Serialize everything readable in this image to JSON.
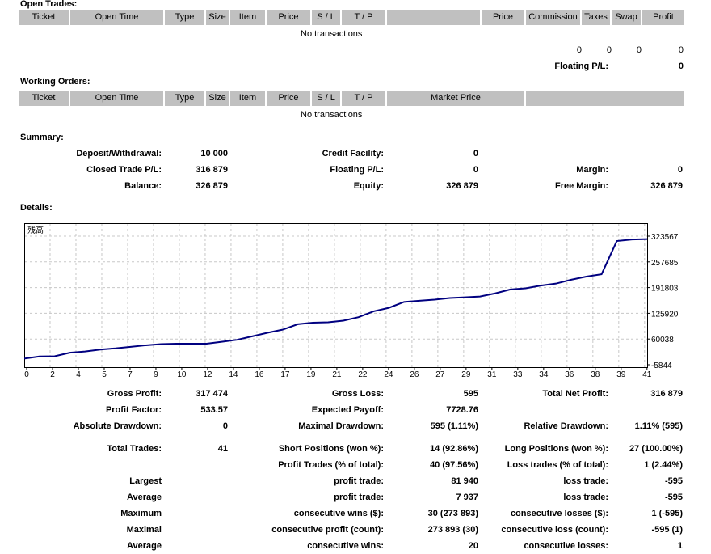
{
  "open_trades": {
    "title": "Open Trades:",
    "columns": [
      "Ticket",
      "Open Time",
      "Type",
      "Size",
      "Item",
      "Price",
      "S / L",
      "T / P",
      "",
      "Price",
      "Commission",
      "Taxes",
      "Swap",
      "Profit"
    ],
    "empty_text": "No transactions",
    "totals": {
      "commission": "0",
      "taxes": "0",
      "swap": "0",
      "profit": "0"
    },
    "floating_label": "Floating P/L:",
    "floating_value": "0"
  },
  "working_orders": {
    "title": "Working Orders:",
    "columns": [
      "Ticket",
      "Open Time",
      "Type",
      "Size",
      "Item",
      "Price",
      "S / L",
      "T / P",
      "Market Price",
      ""
    ],
    "empty_text": "No transactions"
  },
  "summary": {
    "title": "Summary:",
    "rows": [
      [
        "Deposit/Withdrawal:",
        "10 000",
        "Credit Facility:",
        "0",
        "",
        ""
      ],
      [
        "Closed Trade P/L:",
        "316 879",
        "Floating P/L:",
        "0",
        "Margin:",
        "0"
      ],
      [
        "Balance:",
        "326 879",
        "Equity:",
        "326 879",
        "Free Margin:",
        "326 879"
      ]
    ]
  },
  "details": {
    "title": "Details:",
    "stats": [
      [
        "Gross Profit:",
        "317 474",
        "Gross Loss:",
        "595",
        "Total Net Profit:",
        "316 879"
      ],
      [
        "Profit Factor:",
        "533.57",
        "Expected Payoff:",
        "7728.76",
        "",
        ""
      ],
      [
        "Absolute Drawdown:",
        "0",
        "Maximal Drawdown:",
        "595 (1.11%)",
        "Relative Drawdown:",
        "1.11% (595)"
      ],
      [
        "Total Trades:",
        "41",
        "Short Positions (won %):",
        "14 (92.86%)",
        "Long Positions (won %):",
        "27 (100.00%)"
      ],
      [
        "",
        "",
        "Profit Trades (% of total):",
        "40 (97.56%)",
        "Loss trades (% of total):",
        "1 (2.44%)"
      ],
      [
        "Largest",
        "",
        "profit trade:",
        "81 940",
        "loss trade:",
        "-595"
      ],
      [
        "Average",
        "",
        "profit trade:",
        "7 937",
        "loss trade:",
        "-595"
      ],
      [
        "Maximum",
        "",
        "consecutive wins ($):",
        "30 (273 893)",
        "consecutive losses ($):",
        "1 (-595)"
      ],
      [
        "Maximal",
        "",
        "consecutive profit (count):",
        "273 893 (30)",
        "consecutive loss (count):",
        "-595 (1)"
      ],
      [
        "Average",
        "",
        "consecutive wins:",
        "20",
        "consecutive losses:",
        "1"
      ]
    ]
  },
  "chart_data": {
    "type": "line",
    "title": "残高",
    "x": [
      0,
      1,
      2,
      3,
      4,
      5,
      6,
      7,
      8,
      9,
      10,
      11,
      12,
      13,
      14,
      15,
      16,
      17,
      18,
      19,
      20,
      21,
      22,
      23,
      24,
      25,
      26,
      27,
      28,
      29,
      30,
      31,
      32,
      33,
      34,
      35,
      36,
      37,
      38,
      39,
      40,
      41
    ],
    "series": [
      {
        "values": [
          10000,
          15500,
          16000,
          25000,
          28000,
          33000,
          36000,
          40000,
          44000,
          47000,
          48000,
          48000,
          48000,
          53000,
          58000,
          67000,
          76000,
          84000,
          98000,
          102000,
          103000,
          107000,
          116000,
          131000,
          140000,
          155000,
          158000,
          161000,
          165000,
          167000,
          169000,
          177000,
          187000,
          190000,
          197000,
          202000,
          212000,
          220000,
          226000,
          311000,
          315000,
          316000,
          326879
        ]
      }
    ],
    "x_tick_labels": [
      "0",
      "2",
      "4",
      "5",
      "7",
      "9",
      "10",
      "12",
      "14",
      "16",
      "17",
      "19",
      "21",
      "22",
      "24",
      "26",
      "27",
      "29",
      "31",
      "33",
      "34",
      "36",
      "38",
      "39",
      "41"
    ],
    "y_tick_labels": [
      "323567",
      "257685",
      "191803",
      "125920",
      "60038",
      "-5844"
    ],
    "ylim": [
      -5844,
      323567
    ],
    "grid": true,
    "line_color": "#000080"
  }
}
